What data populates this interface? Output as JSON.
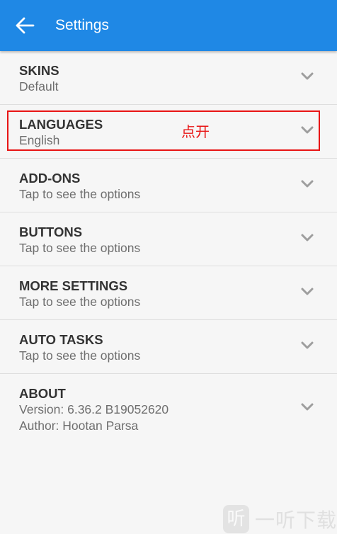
{
  "app_bar": {
    "title": "Settings",
    "color": "#1f88e5",
    "back_icon": "arrow-left-icon"
  },
  "settings": {
    "skins": {
      "title": "SKINS",
      "subtitle": "Default"
    },
    "languages": {
      "title": "LANGUAGES",
      "subtitle": "English"
    },
    "addons": {
      "title": "ADD-ONS",
      "subtitle": "Tap to see the options"
    },
    "buttons": {
      "title": "BUTTONS",
      "subtitle": "Tap to see the options"
    },
    "more_settings": {
      "title": "MORE SETTINGS",
      "subtitle": "Tap to see the options"
    },
    "auto_tasks": {
      "title": "AUTO TASKS",
      "subtitle": "Tap to see the options"
    },
    "about": {
      "title": "ABOUT",
      "version": "Version: 6.36.2  B19052620",
      "author": "Author: Hootan Parsa"
    },
    "expand_icon": "chevron-down-icon"
  },
  "annotation": {
    "text": "点开",
    "color": "#e81515"
  },
  "watermark": {
    "logo_char": "听",
    "text": "一听下载"
  }
}
